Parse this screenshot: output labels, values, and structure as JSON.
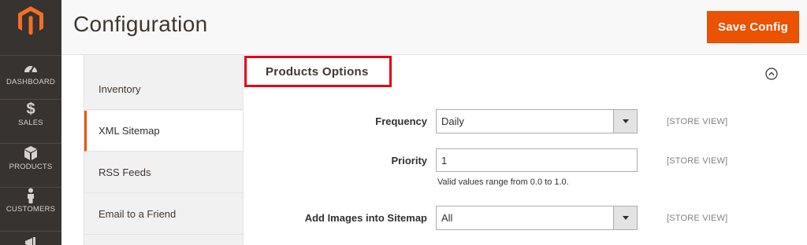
{
  "nav": {
    "items": [
      {
        "label": "DASHBOARD",
        "icon": "dashboard-gauge-icon"
      },
      {
        "label": "SALES",
        "icon": "dollar-icon"
      },
      {
        "label": "PRODUCTS",
        "icon": "cube-icon"
      },
      {
        "label": "CUSTOMERS",
        "icon": "person-icon"
      },
      {
        "label": "",
        "icon": "megaphone-icon"
      }
    ]
  },
  "header": {
    "title": "Configuration",
    "save_label": "Save Config"
  },
  "tabs": {
    "items": [
      {
        "label": "Inventory"
      },
      {
        "label": "XML Sitemap",
        "active": true
      },
      {
        "label": "RSS Feeds"
      },
      {
        "label": "Email to a Friend"
      }
    ]
  },
  "section": {
    "title": "Products Options"
  },
  "fields": {
    "frequency": {
      "label": "Frequency",
      "value": "Daily",
      "scope": "[STORE VIEW]"
    },
    "priority": {
      "label": "Priority",
      "value": "1",
      "scope": "[STORE VIEW]",
      "note": "Valid values range from 0.0 to 1.0."
    },
    "add_images": {
      "label": "Add Images into Sitemap",
      "value": "All",
      "scope": "[STORE VIEW]"
    }
  },
  "colors": {
    "accent": "#eb5202",
    "nav_bg": "#373330",
    "highlight_frame": "#e0001a"
  }
}
